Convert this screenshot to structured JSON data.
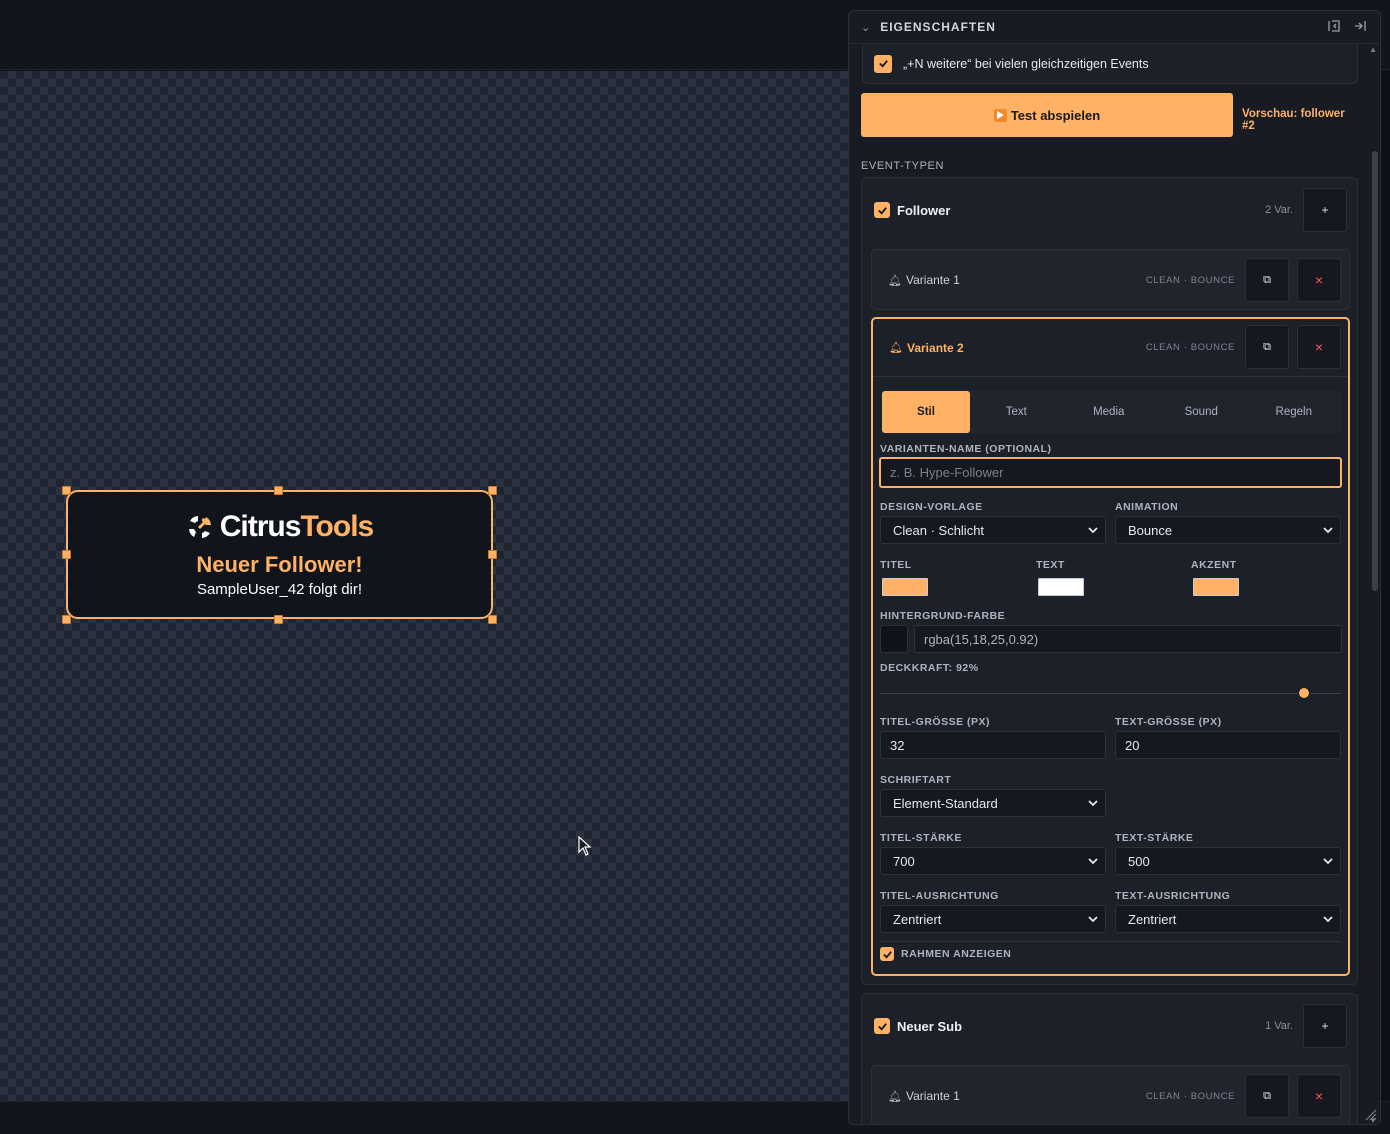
{
  "colors": {
    "accent": "#ffb266",
    "panel_bg": "#181b22",
    "canvas_bg": "#1f2530"
  },
  "alert": {
    "logo_white": "Citrus",
    "logo_accent": "Tools",
    "title": "Neuer Follower!",
    "text": "SampleUser_42 folgt dir!"
  },
  "panel": {
    "title": "EIGENSCHAFTEN",
    "more_events_label": "„+N weitere“ bei vielen gleichzeitigen Events",
    "test_button": "Test abspielen",
    "preview_label": "Vorschau: follower #2",
    "section_label": "EVENT-TYPEN"
  },
  "events": [
    {
      "name": "Follower",
      "count": "2 Var.",
      "add": "+",
      "variants": [
        {
          "name": "Variante 1",
          "meta": "CLEAN · BOUNCE"
        },
        {
          "name": "Variante 2",
          "meta": "CLEAN · BOUNCE"
        }
      ]
    },
    {
      "name": "Neuer Sub",
      "count": "1 Var.",
      "add": "+",
      "variants": [
        {
          "name": "Variante 1",
          "meta": "CLEAN · BOUNCE"
        }
      ]
    }
  ],
  "variant_buttons": {
    "copy": "⧉",
    "delete": "×"
  },
  "editor": {
    "tabs": [
      "Stil",
      "Text",
      "Media",
      "Sound",
      "Regeln"
    ],
    "active_tab": "Stil",
    "name_label": "VARIANTEN-NAME (OPTIONAL)",
    "name_placeholder": "z. B. Hype-Follower",
    "design_label": "DESIGN-VORLAGE",
    "design_value": "Clean · Schlicht",
    "animation_label": "ANIMATION",
    "animation_value": "Bounce",
    "color_title_label": "TITEL",
    "color_text_label": "TEXT",
    "color_accent_label": "AKZENT",
    "color_title": "#ffb266",
    "color_text": "#ffffff",
    "color_accent": "#ffb266",
    "bg_label": "HINTERGRUND-FARBE",
    "bg_value": "rgba(15,18,25,0.92)",
    "opacity_label": "DECKKRAFT: 92%",
    "opacity_value": 0.92,
    "title_size_label": "TITEL-GRÖSSE (PX)",
    "title_size": "32",
    "text_size_label": "TEXT-GRÖSSE (PX)",
    "text_size": "20",
    "font_label": "SCHRIFTART",
    "font_value": "Element-Standard",
    "title_weight_label": "TITEL-STÄRKE",
    "title_weight": "700",
    "text_weight_label": "TEXT-STÄRKE",
    "text_weight": "500",
    "title_align_label": "TITEL-AUSRICHTUNG",
    "title_align": "Zentriert",
    "text_align_label": "TEXT-AUSRICHTUNG",
    "text_align": "Zentriert",
    "border_label": "RAHMEN ANZEIGEN"
  }
}
